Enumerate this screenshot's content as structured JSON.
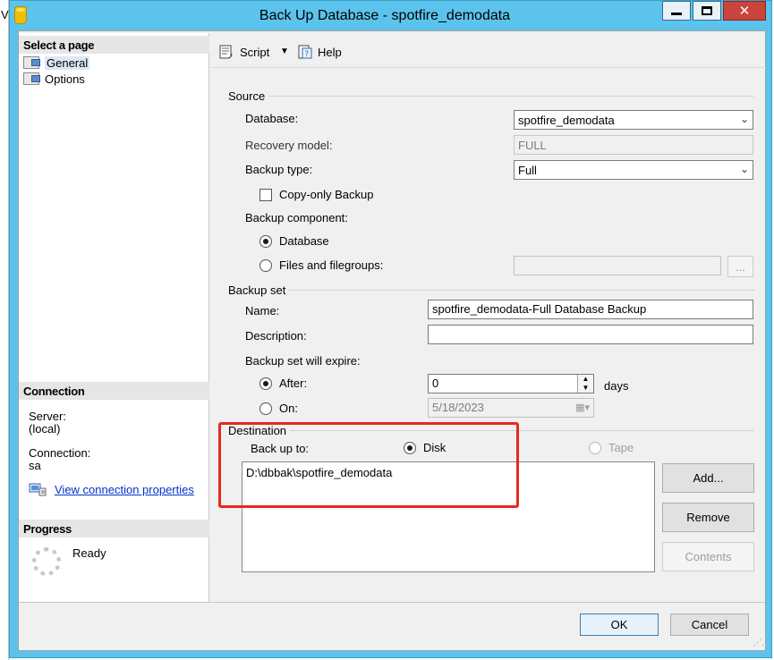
{
  "window": {
    "title": "Back Up Database - spotfire_demodata",
    "edge_text": "Vi",
    "minimize_icon": "minimize-icon",
    "maximize_icon": "maximize-icon",
    "close_icon": "close-icon"
  },
  "left": {
    "select_page_header": "Select a page",
    "pages": [
      {
        "label": "General",
        "icon": "page-icon"
      },
      {
        "label": "Options",
        "icon": "page-icon"
      }
    ],
    "connection_header": "Connection",
    "server_label": "Server:",
    "server_value": "(local)",
    "connection_label": "Connection:",
    "connection_value": "sa",
    "view_connection_link": "View connection properties",
    "progress_header": "Progress",
    "progress_status": "Ready"
  },
  "toolbar": {
    "script_label": "Script",
    "help_label": "Help"
  },
  "source": {
    "group_label": "Source",
    "database_label": "Database:",
    "database_value": "spotfire_demodata",
    "recovery_label": "Recovery model:",
    "recovery_value": "FULL",
    "backup_type_label": "Backup type:",
    "backup_type_value": "Full",
    "copy_only_label": "Copy-only Backup",
    "component_label": "Backup component:",
    "component_database": "Database",
    "component_files": "Files and filegroups:",
    "browse_label": "..."
  },
  "backup_set": {
    "group_label": "Backup set",
    "name_label": "Name:",
    "name_value": "spotfire_demodata-Full Database Backup",
    "description_label": "Description:",
    "description_value": "",
    "expire_label": "Backup set will expire:",
    "after_label": "After:",
    "after_value": "0",
    "days_label": "days",
    "on_label": "On:",
    "on_value": "5/18/2023"
  },
  "destination": {
    "group_label": "Destination",
    "backup_to_label": "Back up to:",
    "disk_label": "Disk",
    "tape_label": "Tape",
    "paths": [
      "D:\\dbbak\\spotfire_demodata"
    ],
    "add_label": "Add...",
    "remove_label": "Remove",
    "contents_label": "Contents"
  },
  "footer": {
    "ok_label": "OK",
    "cancel_label": "Cancel"
  },
  "colors": {
    "title_bar": "#5cc3ec",
    "highlight_box": "#e8281e",
    "link": "#0033cc"
  }
}
